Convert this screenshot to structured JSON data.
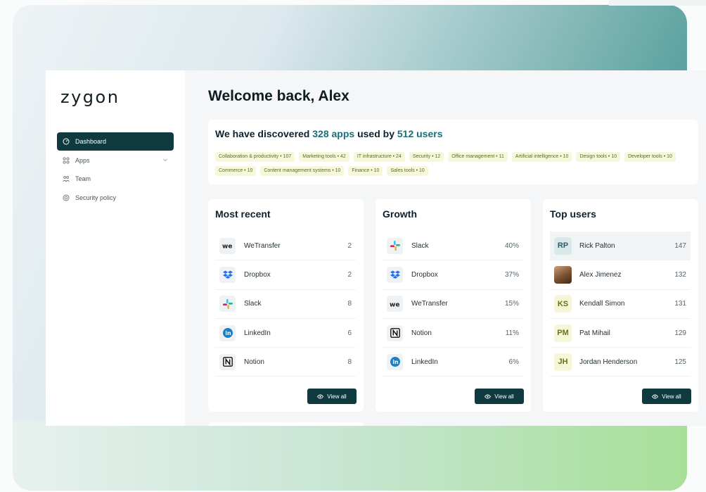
{
  "brand": {
    "logo": "zygon"
  },
  "sidebar": {
    "items": [
      {
        "label": "Dashboard",
        "icon": "dashboard-icon",
        "active": true
      },
      {
        "label": "Apps",
        "icon": "apps-icon",
        "active": false
      },
      {
        "label": "Team",
        "icon": "team-icon",
        "active": false
      },
      {
        "label": "Security policy",
        "icon": "security-icon",
        "active": false
      }
    ]
  },
  "header": {
    "welcome": "Welcome back, Alex"
  },
  "discover": {
    "prefix": "We have discovered ",
    "apps": "328 apps",
    "middle": " used by ",
    "users": "512 users",
    "tags": [
      "Collaboration & productivity • 107",
      "Marketing tools • 42",
      "IT infrastructure • 24",
      "Security • 12",
      "Office management • 11",
      "Artificial intelligence • 10",
      "Design tools • 10",
      "Developer tools • 10",
      "Commerce • 10",
      "Content management systems • 10",
      "Finance • 10",
      "Sales tools • 10"
    ]
  },
  "cards": {
    "recent": {
      "title": "Most recent",
      "rows": [
        {
          "name": "WeTransfer",
          "value": "2",
          "icon": "wetransfer-icon"
        },
        {
          "name": "Dropbox",
          "value": "2",
          "icon": "dropbox-icon"
        },
        {
          "name": "Slack",
          "value": "8",
          "icon": "slack-icon"
        },
        {
          "name": "LinkedIn",
          "value": "6",
          "icon": "linkedin-icon"
        },
        {
          "name": "Notion",
          "value": "8",
          "icon": "notion-icon"
        }
      ],
      "button": "View all"
    },
    "growth": {
      "title": "Growth",
      "rows": [
        {
          "name": "Slack",
          "value": "40%",
          "icon": "slack-icon"
        },
        {
          "name": "Dropbox",
          "value": "37%",
          "icon": "dropbox-icon"
        },
        {
          "name": "WeTransfer",
          "value": "15%",
          "icon": "wetransfer-icon"
        },
        {
          "name": "Notion",
          "value": "11%",
          "icon": "notion-icon"
        },
        {
          "name": "LinkedIn",
          "value": "6%",
          "icon": "linkedin-icon"
        }
      ],
      "button": "View all"
    },
    "top_users": {
      "title": "Top users",
      "rows": [
        {
          "initials": "RP",
          "name": "Rick Palton",
          "value": "147"
        },
        {
          "initials": "",
          "name": "Alex Jimenez",
          "value": "132"
        },
        {
          "initials": "KS",
          "name": "Kendall Simon",
          "value": "131"
        },
        {
          "initials": "PM",
          "name": "Pat Mihail",
          "value": "129"
        },
        {
          "initials": "JH",
          "name": "Jordan Henderson",
          "value": "125"
        }
      ],
      "button": "View all"
    }
  },
  "colors": {
    "primary": "#0e3a40",
    "accent": "#1a6f78",
    "tag_bg": "#f6f8d9"
  }
}
